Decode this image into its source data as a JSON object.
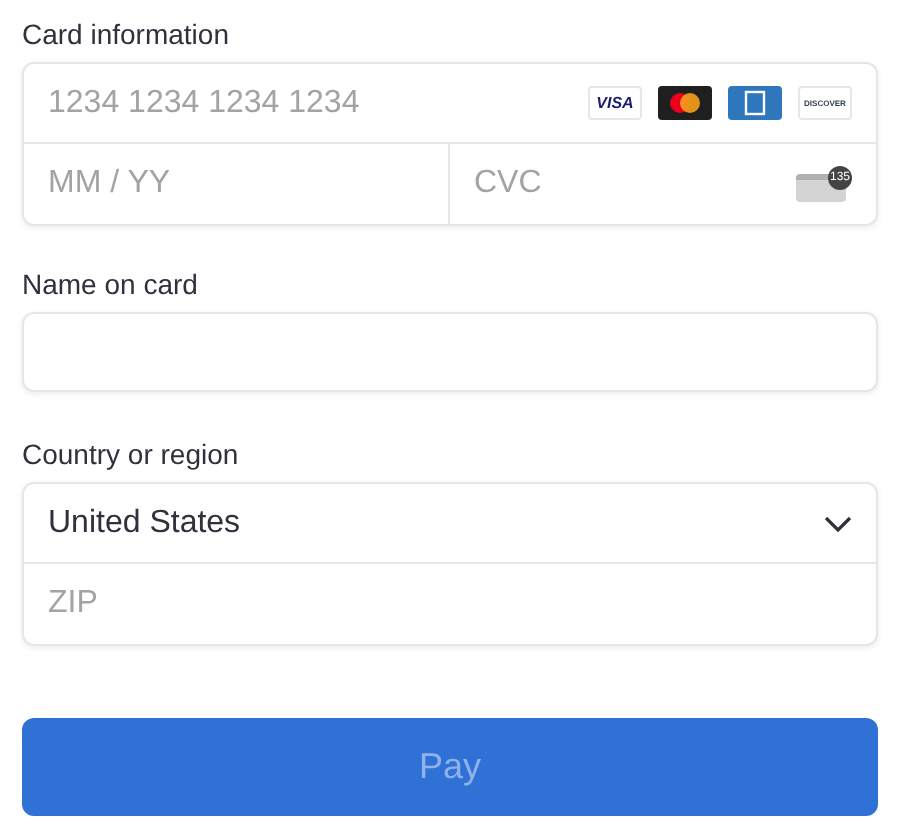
{
  "card_information": {
    "label": "Card information",
    "number_placeholder": "1234 1234 1234 1234",
    "brands": [
      {
        "kind": "visa",
        "text": "VISA"
      },
      {
        "kind": "mastercard"
      },
      {
        "kind": "amex"
      },
      {
        "kind": "discover",
        "text": "DISCOVER"
      }
    ],
    "expiry_placeholder": "MM / YY",
    "cvc_placeholder": "CVC",
    "cvc_badge": "135"
  },
  "name_on_card": {
    "label": "Name on card"
  },
  "country_or_region": {
    "label": "Country or region",
    "value": "United States",
    "zip_placeholder": "ZIP"
  },
  "pay_button": {
    "label": "Pay",
    "disabled": true
  }
}
